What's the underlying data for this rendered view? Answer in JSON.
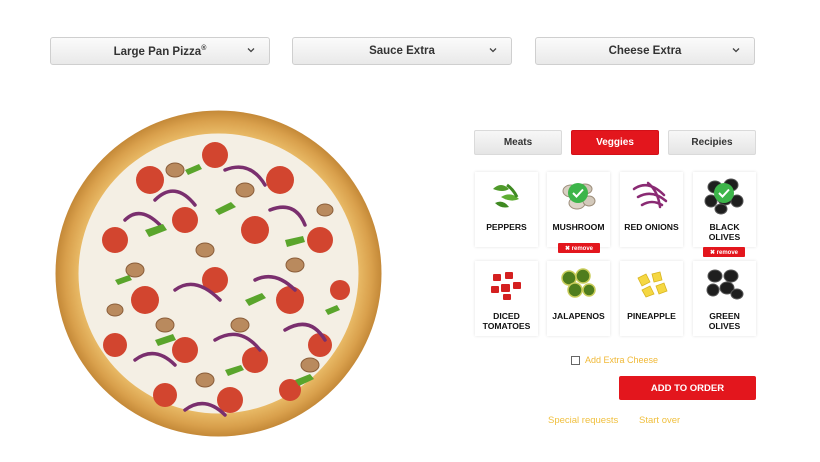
{
  "dropdowns": {
    "size": {
      "label": "Large Pan Pizza",
      "mark": "®"
    },
    "sauce": {
      "label": "Sauce Extra"
    },
    "cheese": {
      "label": "Cheese Extra"
    }
  },
  "tabs": [
    {
      "label": "Meats",
      "active": false
    },
    {
      "label": "Veggies",
      "active": true
    },
    {
      "label": "Recipies",
      "active": false
    }
  ],
  "toppings": [
    {
      "name": "PEPPERS",
      "selected": false
    },
    {
      "name": "MUSHROOM",
      "selected": true
    },
    {
      "name": "RED ONIONS",
      "selected": false
    },
    {
      "name": "BLACK OLIVES",
      "selected": true
    },
    {
      "name": "DICED TOMATOES",
      "selected": false
    },
    {
      "name": "JALAPENOS",
      "selected": false
    },
    {
      "name": "PINEAPPLE",
      "selected": false
    },
    {
      "name": "GREEN OLIVES",
      "selected": false
    }
  ],
  "remove_label": "✖ remove",
  "extra_cheese": {
    "label": "Add Extra Cheese",
    "checked": false
  },
  "add_button": "ADD TO ORDER",
  "links": {
    "special": "Special requests",
    "start_over": "Start over"
  },
  "colors": {
    "brand_red": "#e3161d",
    "link_yellow": "#f0c040",
    "check_green": "#3db54a"
  },
  "icons": {
    "dropdown": "chevron-down-icon",
    "selected": "check-circle-icon"
  }
}
